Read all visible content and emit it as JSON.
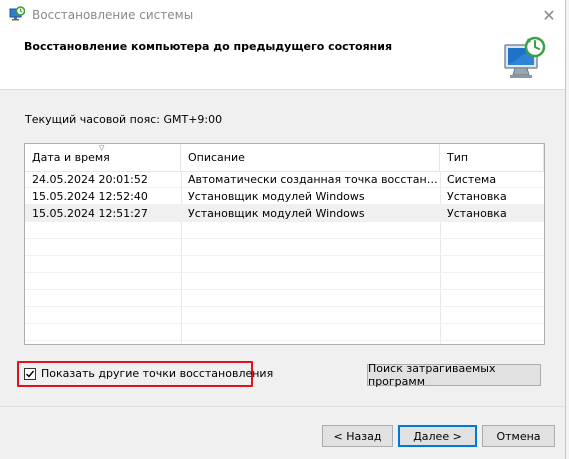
{
  "window": {
    "title": "Восстановление системы",
    "close_glyph": "✕"
  },
  "header": {
    "title": "Восстановление компьютера до предыдущего состояния",
    "icon": "system-restore-monitor-icon"
  },
  "timezone_label": "Текущий часовой пояс: GMT+9:00",
  "table": {
    "columns": [
      "Дата и время",
      "Описание",
      "Тип"
    ],
    "rows": [
      {
        "date": "24.05.2024 20:01:52",
        "description": "Автоматически созданная точка восстановле...",
        "type": "Система"
      },
      {
        "date": "15.05.2024 12:52:40",
        "description": "Установщик модулей Windows",
        "type": "Установка"
      },
      {
        "date": "15.05.2024 12:51:27",
        "description": "Установщик модулей Windows",
        "type": "Установка"
      }
    ],
    "selected_row_index": 2
  },
  "show_more": {
    "label": "Показать другие точки восстановления",
    "checked": true
  },
  "buttons": {
    "scan_affected": "Поиск затрагиваемых программ",
    "back": "< Назад",
    "next": "Далее >",
    "cancel": "Отмена"
  },
  "colors": {
    "highlight_border": "#e0101d",
    "default_button_border": "#0078d7",
    "dialog_bg": "#f0f0f0"
  }
}
